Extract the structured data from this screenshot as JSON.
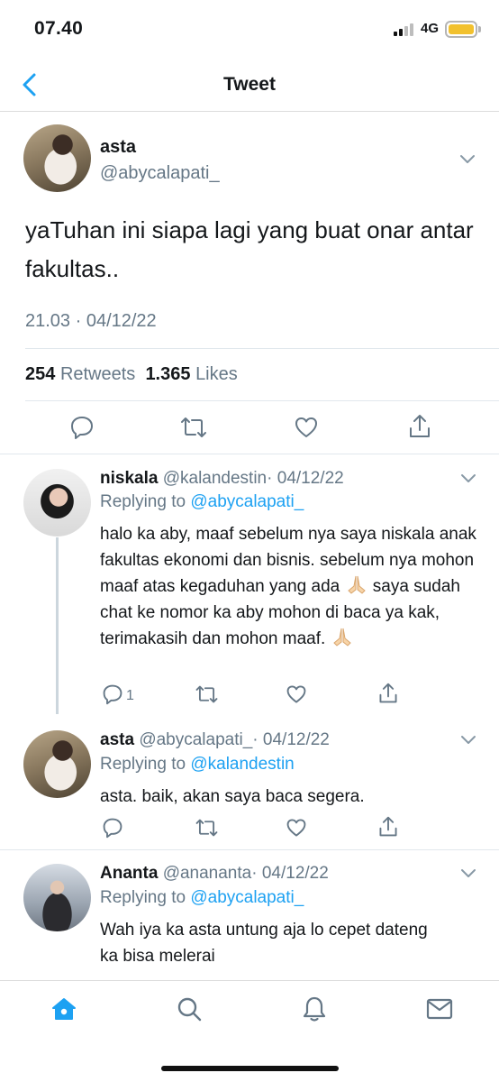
{
  "status_bar": {
    "time": "07.40",
    "network": "4G"
  },
  "header": {
    "title": "Tweet"
  },
  "tweet": {
    "name": "asta",
    "handle": "@abycalapati_",
    "text": "yaTuhan ini siapa lagi yang buat onar antar fakultas..",
    "time": "21.03 · 04/12/22",
    "retweets": "254",
    "retweets_label": "Retweets",
    "likes": "1.365",
    "likes_label": "Likes"
  },
  "replies": [
    {
      "name": "niskala",
      "handle": "@kalandestin",
      "date": "· 04/12/22",
      "replying_label": "Replying to",
      "replying_to": "@abycalapati_",
      "text_1": "halo ka aby, maaf sebelum nya saya niskala anak fakultas ekonomi dan bisnis. sebelum nya mohon maaf atas kegaduhan yang ada",
      "emoji": "folded-hands",
      "text_2": " saya sudah chat ke nomor ka aby mohon di baca ya kak, terimakasih dan mohon maaf. ",
      "reply_count": "1"
    },
    {
      "name": "asta",
      "handle": "@abycalapati_",
      "date": "· 04/12/22",
      "replying_label": "Replying to",
      "replying_to": "@kalandestin",
      "text_1": "asta. baik, akan saya baca segera."
    },
    {
      "name": "Ananta",
      "handle": "@anananta",
      "date": "· 04/12/22",
      "replying_label": "Replying to",
      "replying_to": "@abycalapati_",
      "text_1": "Wah iya ka asta untung aja lo cepet dateng ka bisa melerai"
    }
  ],
  "tabs": [
    "home-icon",
    "search-icon",
    "bell-icon",
    "mail-icon"
  ],
  "colors": {
    "accent": "#1da1f2",
    "muted": "#657786",
    "battery": "#f2c12e"
  }
}
